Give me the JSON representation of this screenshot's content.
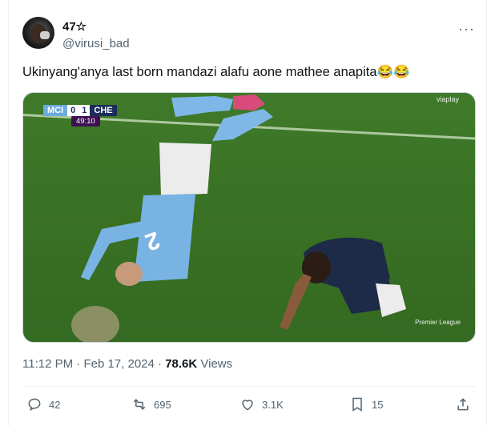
{
  "author": {
    "display_name": "47☆",
    "handle": "@virusi_bad"
  },
  "more_label": "···",
  "tweet": {
    "text": "Ukinyang'anya last born mandazi alafu aone mathee anapita😂😂"
  },
  "media": {
    "scorebug": {
      "home": "MCI",
      "home_score": "0",
      "away_score": "1",
      "away": "CHE",
      "clock": "49:10"
    },
    "broadcaster": "viaplay",
    "watermark": "Premier League"
  },
  "meta": {
    "time": "11:12 PM",
    "separator": "·",
    "date": "Feb 17, 2024",
    "views_count": "78.6K",
    "views_label": "Views"
  },
  "actions": {
    "replies": "42",
    "reposts": "695",
    "likes": "3.1K",
    "bookmarks": "15"
  },
  "colors": {
    "text": "#0f1419",
    "muted": "#536471",
    "border": "#eff3f4",
    "pitch": "#3a7225",
    "city_blue": "#6cabdd"
  }
}
